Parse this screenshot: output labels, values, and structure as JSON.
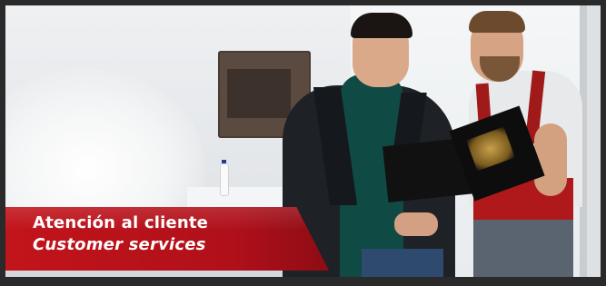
{
  "banner": {
    "title": "Atención al cliente",
    "subtitle": "Customer services"
  },
  "photo": {
    "subject": "customer-service-photo"
  },
  "colors": {
    "banner_red": "#c2141b",
    "frame": "#2a2a2a",
    "text": "#ffffff"
  }
}
